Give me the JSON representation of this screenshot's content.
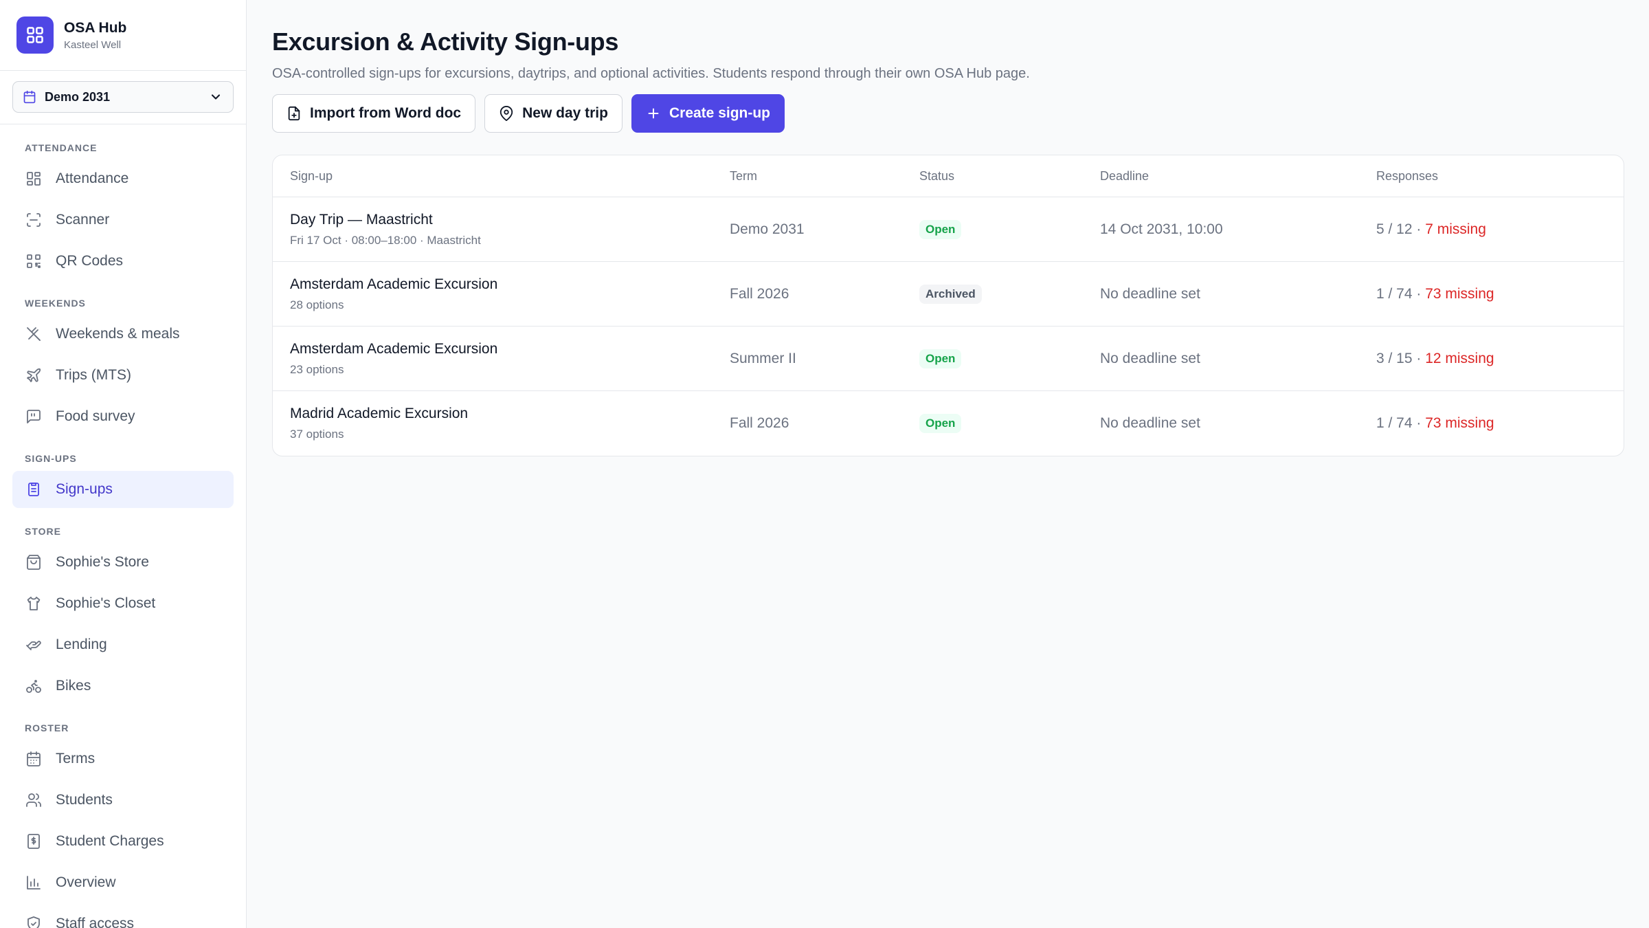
{
  "app": {
    "name": "OSA Hub",
    "subtitle": "Kasteel Well"
  },
  "term_selector": {
    "value": "Demo 2031"
  },
  "sidebar": {
    "sections": [
      {
        "label": "ATTENDANCE",
        "items": [
          {
            "label": "Attendance",
            "icon": "grid-icon"
          },
          {
            "label": "Scanner",
            "icon": "scan-icon"
          },
          {
            "label": "QR Codes",
            "icon": "qr-code-icon"
          }
        ]
      },
      {
        "label": "WEEKENDS",
        "items": [
          {
            "label": "Weekends & meals",
            "icon": "utensils-icon"
          },
          {
            "label": "Trips (MTS)",
            "icon": "plane-icon"
          },
          {
            "label": "Food survey",
            "icon": "message-square-icon"
          }
        ]
      },
      {
        "label": "SIGN-UPS",
        "items": [
          {
            "label": "Sign-ups",
            "icon": "clipboard-icon",
            "active": true
          }
        ]
      },
      {
        "label": "STORE",
        "items": [
          {
            "label": "Sophie's Store",
            "icon": "shopping-bag-icon"
          },
          {
            "label": "Sophie's Closet",
            "icon": "shirt-icon"
          },
          {
            "label": "Lending",
            "icon": "hand-icon"
          },
          {
            "label": "Bikes",
            "icon": "bike-icon"
          }
        ]
      },
      {
        "label": "ROSTER",
        "items": [
          {
            "label": "Terms",
            "icon": "calendar-icon"
          },
          {
            "label": "Students",
            "icon": "users-icon"
          },
          {
            "label": "Student Charges",
            "icon": "receipt-icon"
          },
          {
            "label": "Overview",
            "icon": "bar-chart-icon"
          },
          {
            "label": "Staff access",
            "icon": "shield-icon"
          }
        ]
      }
    ]
  },
  "page": {
    "title": "Excursion & Activity Sign-ups",
    "subtitle": "OSA-controlled sign-ups for excursions, daytrips, and optional activities. Students respond through their own OSA Hub page."
  },
  "actions": {
    "import": "Import from Word doc",
    "day_trip": "New day trip",
    "create": "Create sign-up"
  },
  "table": {
    "headers": [
      "Sign-up",
      "Term",
      "Status",
      "Deadline",
      "Responses"
    ],
    "rows": [
      {
        "title": "Day Trip — Maastricht",
        "sub": "Fri 17 Oct · 08:00–18:00 · Maastricht",
        "term": "Demo 2031",
        "status": "Open",
        "deadline": "14 Oct 2031, 10:00",
        "responses": "5 / 12 · ",
        "missing": "7 missing"
      },
      {
        "title": "Amsterdam Academic Excursion",
        "sub": "28 options",
        "term": "Fall 2026",
        "status": "Archived",
        "deadline": "No deadline set",
        "responses": "1 / 74 · ",
        "missing": "73 missing"
      },
      {
        "title": "Amsterdam Academic Excursion",
        "sub": "23 options",
        "term": "Summer II",
        "status": "Open",
        "deadline": "No deadline set",
        "responses": "3 / 15 · ",
        "missing": "12 missing"
      },
      {
        "title": "Madrid Academic Excursion",
        "sub": "37 options",
        "term": "Fall 2026",
        "status": "Open",
        "deadline": "No deadline set",
        "responses": "1 / 74 · ",
        "missing": "73 missing"
      }
    ]
  },
  "colors": {
    "accent": "#4f46e5",
    "open": "#16a34a",
    "missing": "#dc2626"
  }
}
